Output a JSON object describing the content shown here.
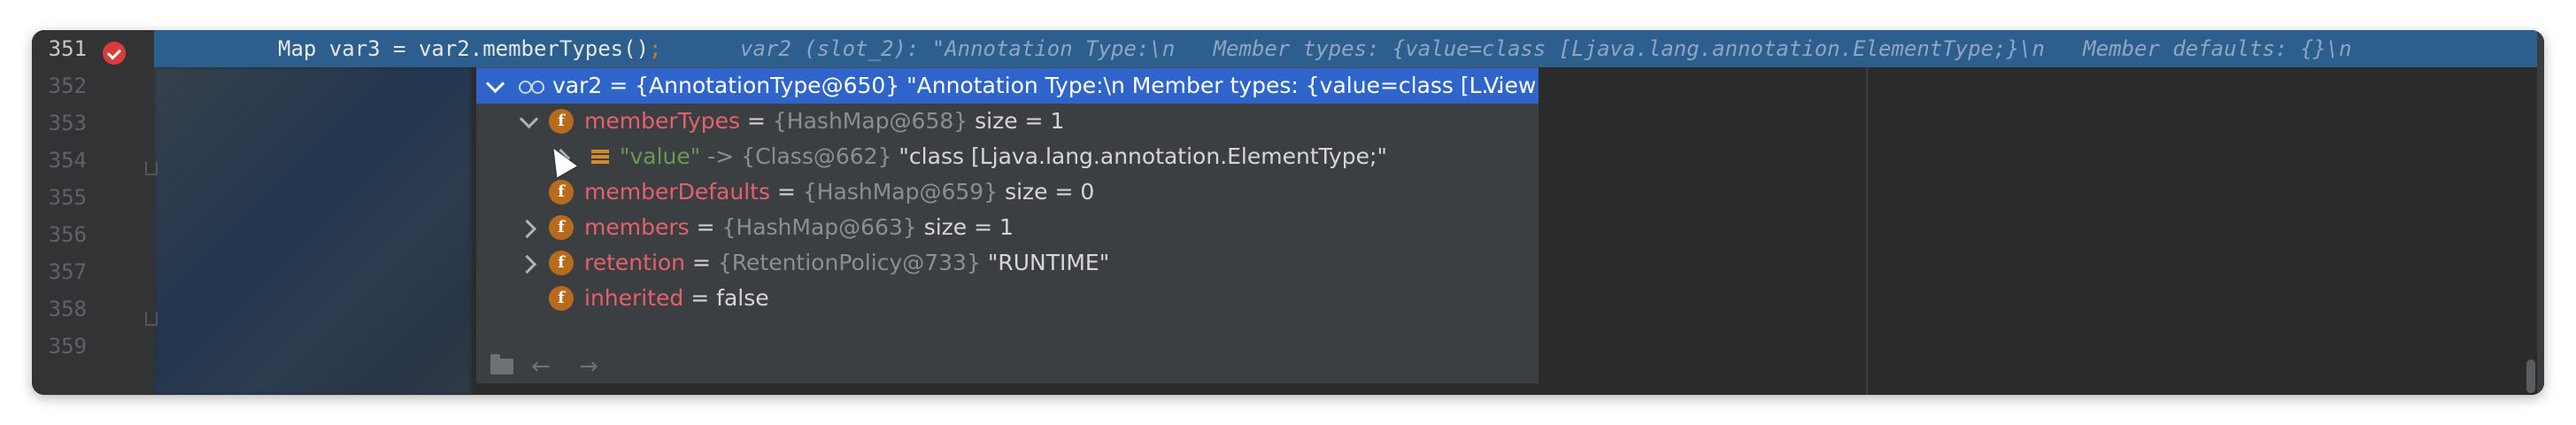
{
  "editor": {
    "line_numbers": [
      "351",
      "352",
      "353",
      "354",
      "355",
      "356",
      "357",
      "358",
      "359"
    ],
    "current_line": {
      "code": "Map var3 = var2.memberTypes()",
      "semicolon": ";",
      "inline_value": "var2 (slot_2): \"Annotation Type:\\n   Member types: {value=class [Ljava.lang.annotation.ElementType;}\\n   Member defaults: {}\\n"
    }
  },
  "debug_popup": {
    "header": {
      "text": "var2 = {AnnotationType@650} \"Annotation Type:\\n  Member types: {value=class [L...",
      "view_link": "View"
    },
    "rows": [
      {
        "name": "memberTypes",
        "eq": " = ",
        "ref": "{HashMap@658}",
        "value": "  size = 1"
      },
      {
        "key": "\"value\"",
        "arrow": " -> ",
        "ref": "{Class@662}",
        "value": " \"class [Ljava.lang.annotation.ElementType;\""
      },
      {
        "name": "memberDefaults",
        "eq": " = ",
        "ref": "{HashMap@659}",
        "value": "  size = 0"
      },
      {
        "name": "members",
        "eq": " = ",
        "ref": "{HashMap@663}",
        "value": "  size = 1"
      },
      {
        "name": "retention",
        "eq": " = ",
        "ref": "{RetentionPolicy@733}",
        "value": " \"RUNTIME\""
      },
      {
        "name": "inherited",
        "eq": " = ",
        "value": "false"
      }
    ],
    "toolbar": {
      "back_arrow": "←",
      "forward_arrow": "→"
    }
  },
  "icons": {
    "breakpoint": "breakpoint-check-icon",
    "watch": "glasses-icon",
    "field": "field-icon",
    "map_entry": "map-entry-icon",
    "folder": "folder-icon"
  },
  "colors": {
    "exec_line": "#2d5f8e",
    "popup_header": "#2f65ca",
    "field_name": "#e3616c",
    "breakpoint": "#db3b3b",
    "field_icon": "#b86b1c"
  }
}
